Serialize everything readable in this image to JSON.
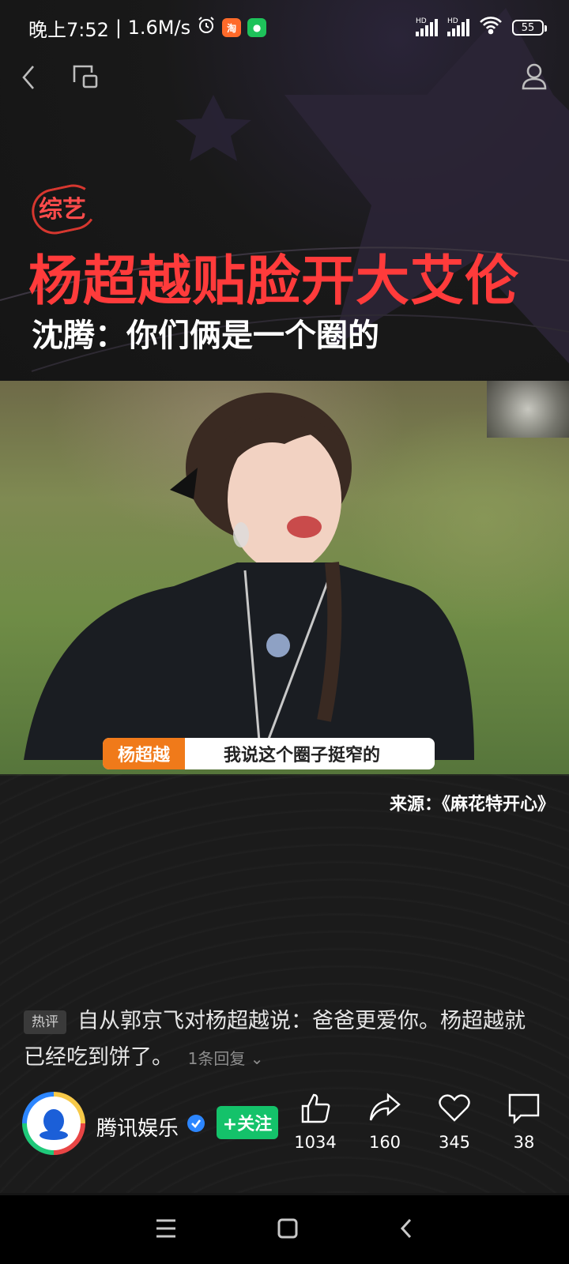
{
  "status_bar": {
    "time": "晚上7:52",
    "speed": "| 1.6M/s",
    "signal1_label": "HD",
    "signal2_label": "HD",
    "battery": "55"
  },
  "article": {
    "category": "综艺",
    "title": "杨超越贴脸开大艾伦",
    "subtitle": "沈腾：你们俩是一个圈的"
  },
  "video": {
    "speaker_name": "杨超越",
    "caption": "我说这个圈子挺窄的",
    "source": "来源：《麻花特开心》"
  },
  "hot_comment": {
    "badge": "热评",
    "text": "自从郭京飞对杨超越说：爸爸更爱你。杨超越就已经吃到饼了。",
    "reply_link": "1条回复"
  },
  "author": {
    "name": "腾讯娱乐",
    "follow_label": "+关注"
  },
  "actions": {
    "like_count": "1034",
    "share_count": "160",
    "favorite_count": "345",
    "comment_count": "38"
  },
  "colors": {
    "title_red": "#ff3b3b",
    "follow_green": "#14c26a",
    "caption_orange": "#f07a1a"
  }
}
